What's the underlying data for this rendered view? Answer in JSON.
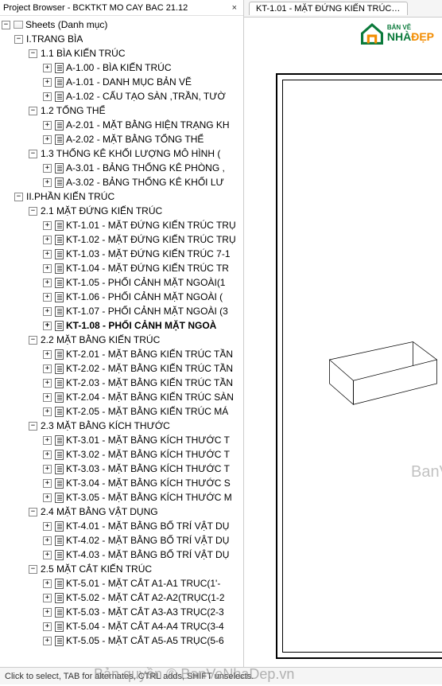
{
  "panel": {
    "title": "Project Browser - BCKTKT MO CAY BAC 21.12"
  },
  "tab": {
    "label": "KT-1.01 - MẶT ĐỨNG KIẾN TRÚC T..."
  },
  "logo": {
    "small": "BẢN VẼ",
    "nha": "NHÀ",
    "dep": "ĐẸP"
  },
  "watermark": {
    "w1": "BanVeNhaDep.vn",
    "w2": "Bản quyền © BanVeNhaDep.vn"
  },
  "status": {
    "text": "Click to select, TAB for alternates, CTRL adds, SHIFT unselects."
  },
  "tree": [
    {
      "ind": 0,
      "tg": "-",
      "icon": "folder",
      "label": "Sheets (Danh mục)",
      "int": true
    },
    {
      "ind": 1,
      "tg": "-",
      "icon": "",
      "label": "I.TRANG BÌA",
      "int": true
    },
    {
      "ind": 2,
      "tg": "-",
      "icon": "",
      "label": "1.1 BÌA KIẾN TRÚC",
      "int": true
    },
    {
      "ind": 3,
      "tg": "+",
      "icon": "sheet",
      "label": "A-1.00 - BÌA KIẾN TRÚC",
      "int": true
    },
    {
      "ind": 3,
      "tg": "+",
      "icon": "sheet",
      "label": "A-1.01 - DANH MỤC BẢN VẼ",
      "int": true
    },
    {
      "ind": 3,
      "tg": "+",
      "icon": "sheet",
      "label": "A-1.02 - CẤU TẠO SÀN ,TRẦN, TƯỜ",
      "int": true
    },
    {
      "ind": 2,
      "tg": "-",
      "icon": "",
      "label": "1.2 TỔNG THỂ",
      "int": true
    },
    {
      "ind": 3,
      "tg": "+",
      "icon": "sheet",
      "label": "A-2.01 - MẶT BẰNG HIỆN TRẠNG KH",
      "int": true
    },
    {
      "ind": 3,
      "tg": "+",
      "icon": "sheet",
      "label": "A-2.02 - MẶT BẰNG TỔNG THỂ",
      "int": true
    },
    {
      "ind": 2,
      "tg": "-",
      "icon": "",
      "label": "1.3 THỐNG KÊ KHỐI LƯỢNG MÔ HÌNH (",
      "int": true
    },
    {
      "ind": 3,
      "tg": "+",
      "icon": "sheet",
      "label": "A-3.01 - BẢNG THỐNG KÊ PHÒNG ,",
      "int": true
    },
    {
      "ind": 3,
      "tg": "+",
      "icon": "sheet",
      "label": "A-3.02 - BẢNG THỐNG KÊ KHỐI LƯ",
      "int": true
    },
    {
      "ind": 1,
      "tg": "-",
      "icon": "",
      "label": "II.PHẦN KIẾN TRÚC",
      "int": true
    },
    {
      "ind": 2,
      "tg": "-",
      "icon": "",
      "label": "2.1 MẶT ĐỨNG KIẾN TRÚC",
      "int": true
    },
    {
      "ind": 3,
      "tg": "+",
      "icon": "sheet",
      "label": "KT-1.01 - MẶT ĐỨNG KIẾN TRÚC TRỤ",
      "int": true
    },
    {
      "ind": 3,
      "tg": "+",
      "icon": "sheet",
      "label": "KT-1.02 - MẶT ĐỨNG KIẾN TRÚC TRỤ",
      "int": true
    },
    {
      "ind": 3,
      "tg": "+",
      "icon": "sheet",
      "label": "KT-1.03 - MẶT ĐỨNG KIẾN TRÚC 7-1",
      "int": true
    },
    {
      "ind": 3,
      "tg": "+",
      "icon": "sheet",
      "label": "KT-1.04 - MẶT ĐỨNG  KIẾN TRÚC TR",
      "int": true
    },
    {
      "ind": 3,
      "tg": "+",
      "icon": "sheet",
      "label": "KT-1.05 - PHỐI CẢNH MẶT NGOÀI(1",
      "int": true
    },
    {
      "ind": 3,
      "tg": "+",
      "icon": "sheet",
      "label": "KT-1.06 - PHỐI CẢNH MẶT NGOÀI (",
      "int": true
    },
    {
      "ind": 3,
      "tg": "+",
      "icon": "sheet",
      "label": "KT-1.07 - PHỐI CẢNH MẶT NGOÀI (3",
      "int": true
    },
    {
      "ind": 3,
      "tg": "+",
      "icon": "sheet",
      "label": "KT-1.08 - PHỐI CẢNH MẶT NGOÀ",
      "int": true,
      "sel": true
    },
    {
      "ind": 2,
      "tg": "-",
      "icon": "",
      "label": "2.2 MẶT BẰNG KIẾN TRÚC",
      "int": true
    },
    {
      "ind": 3,
      "tg": "+",
      "icon": "sheet",
      "label": "KT-2.01 - MẶT BẰNG KIẾN TRÚC TẦN",
      "int": true
    },
    {
      "ind": 3,
      "tg": "+",
      "icon": "sheet",
      "label": "KT-2.02 - MẶT BẰNG KIẾN TRÚC TẦN",
      "int": true
    },
    {
      "ind": 3,
      "tg": "+",
      "icon": "sheet",
      "label": "KT-2.03 - MẶT BẰNG KIẾN TRÚC TẦN",
      "int": true
    },
    {
      "ind": 3,
      "tg": "+",
      "icon": "sheet",
      "label": "KT-2.04 - MẶT BẰNG KIẾN TRÚC SÀN",
      "int": true
    },
    {
      "ind": 3,
      "tg": "+",
      "icon": "sheet",
      "label": "KT-2.05 - MẶT BẰNG KIẾN TRÚC MÁ",
      "int": true
    },
    {
      "ind": 2,
      "tg": "-",
      "icon": "",
      "label": "2.3 MẶT BẰNG KÍCH THƯỚC",
      "int": true
    },
    {
      "ind": 3,
      "tg": "+",
      "icon": "sheet",
      "label": "KT-3.01 - MẶT BẰNG KÍCH THƯỚC T",
      "int": true
    },
    {
      "ind": 3,
      "tg": "+",
      "icon": "sheet",
      "label": "KT-3.02 - MẶT BẰNG KÍCH THƯỚC T",
      "int": true
    },
    {
      "ind": 3,
      "tg": "+",
      "icon": "sheet",
      "label": "KT-3.03 - MẶT BẰNG KÍCH THƯỚC T",
      "int": true
    },
    {
      "ind": 3,
      "tg": "+",
      "icon": "sheet",
      "label": "KT-3.04 - MẶT BẰNG KÍCH THƯỚC S",
      "int": true
    },
    {
      "ind": 3,
      "tg": "+",
      "icon": "sheet",
      "label": "KT-3.05 - MẶT BẰNG KÍCH THƯỚC M",
      "int": true
    },
    {
      "ind": 2,
      "tg": "-",
      "icon": "",
      "label": "2.4 MẶT BẰNG VẬT DỤNG",
      "int": true
    },
    {
      "ind": 3,
      "tg": "+",
      "icon": "sheet",
      "label": "KT-4.01 - MẶT BẰNG BỐ TRÍ VẬT DỤ",
      "int": true
    },
    {
      "ind": 3,
      "tg": "+",
      "icon": "sheet",
      "label": "KT-4.02 - MẶT BẰNG BỐ TRÍ VẬT DỤ",
      "int": true
    },
    {
      "ind": 3,
      "tg": "+",
      "icon": "sheet",
      "label": "KT-4.03 - MẶT BẰNG BỐ TRÍ VẬT DỤ",
      "int": true
    },
    {
      "ind": 2,
      "tg": "-",
      "icon": "",
      "label": "2.5 MẶT CẮT KIẾN TRÚC",
      "int": true
    },
    {
      "ind": 3,
      "tg": "+",
      "icon": "sheet",
      "label": "KT-5.01 - MẶT CẮT A1-A1 TRUC(1'-",
      "int": true
    },
    {
      "ind": 3,
      "tg": "+",
      "icon": "sheet",
      "label": "KT-5.02 - MẶT CẮT A2-A2(TRỤC(1-2",
      "int": true
    },
    {
      "ind": 3,
      "tg": "+",
      "icon": "sheet",
      "label": "KT-5.03 - MẶT CẮT A3-A3 TRỤC(2-3",
      "int": true
    },
    {
      "ind": 3,
      "tg": "+",
      "icon": "sheet",
      "label": "KT-5.04 - MẶT CẮT A4-A4 TRỤC(3-4",
      "int": true
    },
    {
      "ind": 3,
      "tg": "+",
      "icon": "sheet",
      "label": "KT-5.05 - MẶT CẮT A5-A5 TRỤC(5-6",
      "int": true
    }
  ]
}
